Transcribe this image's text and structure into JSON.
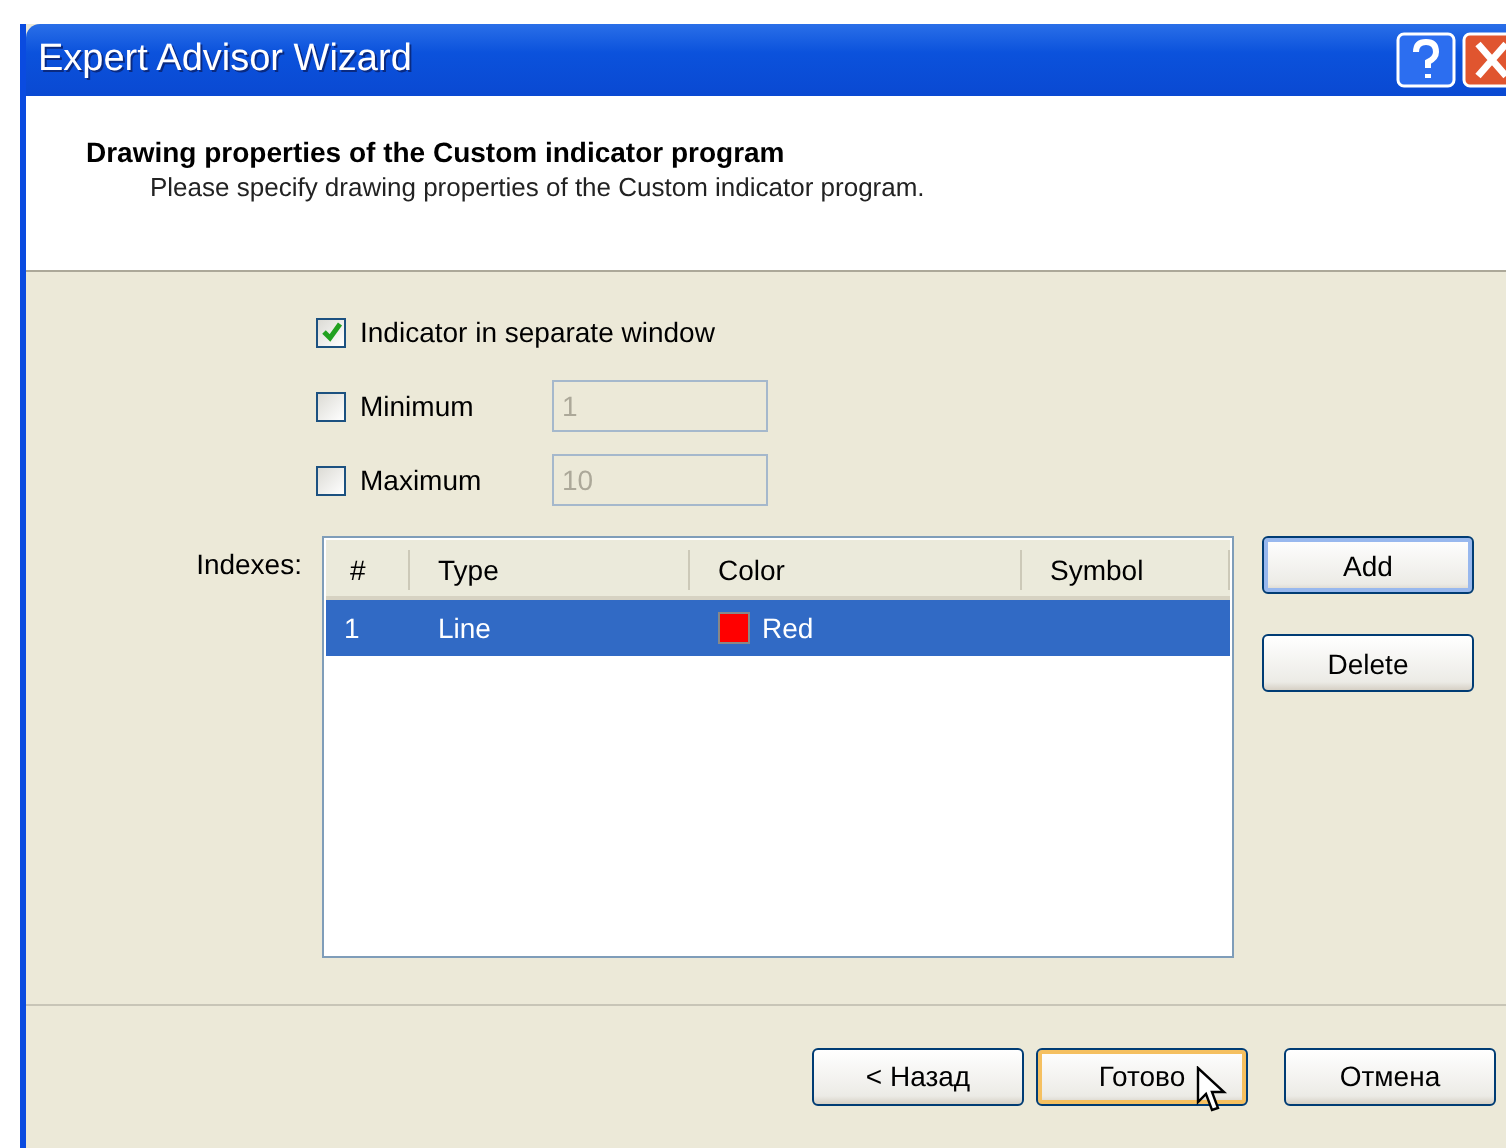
{
  "window": {
    "title": "Expert Advisor Wizard"
  },
  "header": {
    "title": "Drawing properties of the Custom indicator program",
    "subtitle": "Please specify drawing properties of the Custom indicator program."
  },
  "options": [
    {
      "kind": "checkbox",
      "label": "Indicator in separate window",
      "checked": true
    },
    {
      "kind": "checkbox-field",
      "label": "Minimum",
      "checked": false,
      "value": "1",
      "disabled": true
    },
    {
      "kind": "checkbox-field",
      "label": "Maximum",
      "checked": false,
      "value": "10",
      "disabled": true
    }
  ],
  "indexes": {
    "label": "Indexes:",
    "columns": [
      "#",
      "Type",
      "Color",
      "Symbol"
    ],
    "rows": [
      {
        "index": "1",
        "type": "Line",
        "color_name": "Red",
        "color": "#ff0000",
        "symbol": "",
        "selected": true
      }
    ],
    "buttons": [
      "Add",
      "Delete"
    ]
  },
  "footer": {
    "buttons": [
      {
        "label": "< Назад",
        "focused": false
      },
      {
        "label": "Готово",
        "focused": true
      },
      {
        "label": "Отмена",
        "focused": false
      }
    ]
  }
}
